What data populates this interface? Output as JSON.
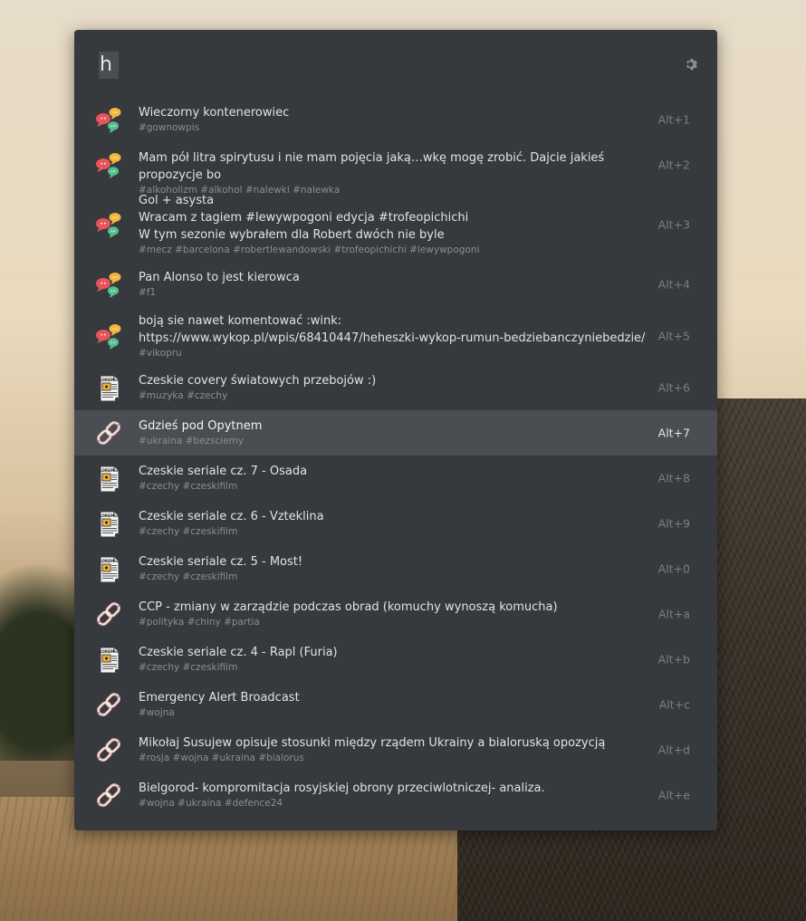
{
  "search": {
    "value": "h",
    "placeholder": ""
  },
  "settings": {
    "icon": "gear-icon"
  },
  "results": [
    {
      "icon": "chat-bubbles-icon",
      "title": "Wieczorny kontenerowiec",
      "tags": "#gownowpis",
      "shortcut": "Alt+1"
    },
    {
      "icon": "chat-bubbles-icon",
      "title": "Mam pół litra spirytusu i nie mam pojęcia jaką…wkę mogę zrobić. Dajcie jakieś propozycje bo",
      "tags": "#alkoholizm #alkohol #nalewki #nalewka",
      "shortcut": "Alt+2"
    },
    {
      "icon": "chat-bubbles-icon",
      "title": "Gol + asysta\nWracam z tagiem #lewywpogoni edycja #trofeopichichi\nW tym sezonie wybrałem dla Robert dwóch nie byle",
      "tags": "#mecz #barcelona #robertlewandowski #trofeopichichi #lewywpogoni",
      "shortcut": "Alt+3"
    },
    {
      "icon": "chat-bubbles-icon",
      "title": "Pan Alonso to jest kierowca",
      "tags": "#f1",
      "shortcut": "Alt+4"
    },
    {
      "icon": "chat-bubbles-icon",
      "title": "boją sie nawet komentować :wink:\nhttps://www.wykop.pl/wpis/68410447/heheszki-wykop-rumun-bedziebanczyniebedzie/",
      "tags": "#vikopru",
      "shortcut": "Alt+5"
    },
    {
      "icon": "document-icon",
      "title": "Czeskie covery światowych przebojów :)",
      "tags": "#muzyka #czechy",
      "shortcut": "Alt+6"
    },
    {
      "icon": "link-icon",
      "title": "Gdzieś pod Opytnem",
      "tags": "#ukraina #bezsciemy",
      "shortcut": "Alt+7"
    },
    {
      "icon": "document-icon",
      "title": "Czeskie seriale cz. 7 - Osada",
      "tags": "#czechy #czeskifilm",
      "shortcut": "Alt+8"
    },
    {
      "icon": "document-icon",
      "title": "Czeskie seriale cz. 6 - Vzteklina",
      "tags": "#czechy #czeskifilm",
      "shortcut": "Alt+9"
    },
    {
      "icon": "document-icon",
      "title": "Czeskie seriale cz. 5 - Most!",
      "tags": "#czechy #czeskifilm",
      "shortcut": "Alt+0"
    },
    {
      "icon": "link-icon",
      "title": "CCP - zmiany w zarządzie podczas obrad (komuchy wynoszą komucha)",
      "tags": "#polityka #chiny #partia",
      "shortcut": "Alt+a"
    },
    {
      "icon": "document-icon",
      "title": "Czeskie seriale cz. 4 - Rapl (Furia)",
      "tags": "#czechy #czeskifilm",
      "shortcut": "Alt+b"
    },
    {
      "icon": "link-icon",
      "title": "Emergency Alert Broadcast",
      "tags": "#wojna",
      "shortcut": "Alt+c"
    },
    {
      "icon": "link-icon",
      "title": "Mikołaj Susujew opisuje stosunki między rządem Ukrainy a bialoruską opozycją",
      "tags": "#rosja #wojna #ukraina #bialorus",
      "shortcut": "Alt+d"
    },
    {
      "icon": "link-icon",
      "title": "Bielgorod- kompromitacja rosyjskiej obrony przeciwlotniczej- analiza.",
      "tags": "#wojna #ukraina #defence24",
      "shortcut": "Alt+e"
    }
  ],
  "document_icon_text": "LOREM"
}
